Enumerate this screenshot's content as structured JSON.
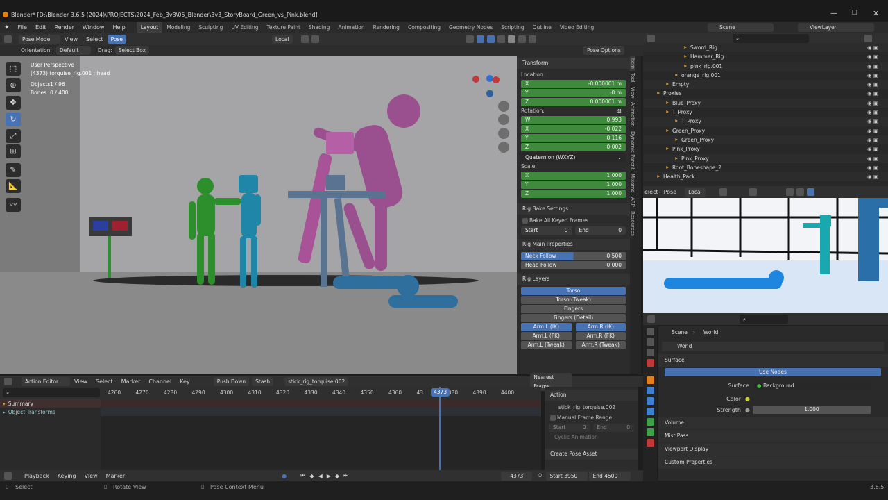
{
  "window": {
    "title": "Blender* [D:\\Blender 3.6.5 (2024)\\PROJECTS\\2024_Feb_3v3\\05_Blender\\3v3_StoryBoard_Green_vs_Pink.blend]"
  },
  "menu": [
    "File",
    "Edit",
    "Render",
    "Window",
    "Help"
  ],
  "workspaces": [
    "Layout",
    "Modeling",
    "Sculpting",
    "UV Editing",
    "Texture Paint",
    "Shading",
    "Animation",
    "Rendering",
    "Compositing",
    "Geometry Nodes",
    "Scripting",
    "Outline",
    "Video Editing"
  ],
  "scene": "Scene",
  "view_layer": "ViewLayer",
  "viewport_header": {
    "mode": "Pose Mode",
    "view": "View",
    "select": "Select",
    "pose": "Pose",
    "orient": "Local",
    "orientation_label": "Orientation:",
    "orientation_value": "Default",
    "drag_label": "Drag:",
    "drag_value": "Select Box",
    "pose_options": "Pose Options"
  },
  "viewport_overlay": {
    "perspective": "User Perspective",
    "object": "(4373) torquise_rig.001 : head",
    "objects_label": "Objects",
    "objects_value": "1 / 96",
    "bones_label": "Bones",
    "bones_value": "0 / 400"
  },
  "npanel": {
    "transform": "Transform",
    "location": "Location:",
    "loc": [
      {
        "a": "X",
        "v": "-0.000001 m"
      },
      {
        "a": "Y",
        "v": "-0 m"
      },
      {
        "a": "Z",
        "v": "0.000001 m"
      }
    ],
    "rotation": "Rotation:",
    "rot_mode_short": "4L",
    "rot": [
      {
        "a": "W",
        "v": "0.993"
      },
      {
        "a": "X",
        "v": "-0.022"
      },
      {
        "a": "Y",
        "v": "0.116"
      },
      {
        "a": "Z",
        "v": "0.002"
      }
    ],
    "quat": "Quaternion (WXYZ)",
    "scale": "Scale:",
    "scl": [
      {
        "a": "X",
        "v": "1.000"
      },
      {
        "a": "Y",
        "v": "1.000"
      },
      {
        "a": "Z",
        "v": "1.000"
      }
    ],
    "rig_bake": "Rig Bake Settings",
    "bake_all": "Bake All Keyed Frames",
    "start": "Start",
    "start_v": "0",
    "end": "End",
    "end_v": "0",
    "rig_main": "Rig Main Properties",
    "neck_follow": "Neck Follow",
    "neck_v": "0.500",
    "head_follow": "Head Follow",
    "head_v": "0.000",
    "rig_layers": "Rig Layers",
    "torso": "Torso",
    "torso_tweak": "Torso (Tweak)",
    "fingers": "Fingers",
    "fingers_detail": "Fingers (Detail)",
    "arm_l_ik": "Arm.L (IK)",
    "arm_r_ik": "Arm.R (IK)",
    "arm_l_fk": "Arm.L (FK)",
    "arm_r_fk": "Arm.R (FK)",
    "arm_l_tw": "Arm.L (Tweak)",
    "arm_r_tw": "Arm.R (Tweak)"
  },
  "ntabs": [
    "Item",
    "Tool",
    "View",
    "Animation",
    "Dynamic Parent",
    "Mixamo",
    "ARP",
    "Resources"
  ],
  "outliner": [
    {
      "name": "Sword_Rig",
      "indent": 4
    },
    {
      "name": "Hammer_Rig",
      "indent": 4
    },
    {
      "name": "pink_rig.001",
      "indent": 4
    },
    {
      "name": "orange_rig.001",
      "indent": 3
    },
    {
      "name": "Empty",
      "indent": 2
    },
    {
      "name": "Proxies",
      "indent": 1
    },
    {
      "name": "Blue_Proxy",
      "indent": 2
    },
    {
      "name": "T_Proxy",
      "indent": 2
    },
    {
      "name": "T_Proxy",
      "indent": 3
    },
    {
      "name": "Green_Proxy",
      "indent": 2
    },
    {
      "name": "Green_Proxy",
      "indent": 3
    },
    {
      "name": "Pink_Proxy",
      "indent": 2
    },
    {
      "name": "Pink_Proxy",
      "indent": 3
    },
    {
      "name": "Root_Boneshape_2",
      "indent": 2
    },
    {
      "name": "Health_Pack",
      "indent": 1
    }
  ],
  "preview_header": {
    "select": "elect",
    "pose": "Pose",
    "orient": "Local"
  },
  "props": {
    "scene": "Scene",
    "world": "World",
    "world_name": "World",
    "surface": "Surface",
    "use_nodes": "Use Nodes",
    "surface_label": "Surface",
    "surface_value": "Background",
    "color": "Color",
    "strength": "Strength",
    "strength_v": "1.000",
    "volume": "Volume",
    "mist": "Mist Pass",
    "viewport_display": "Viewport Display",
    "custom_props": "Custom Properties"
  },
  "action_editor": {
    "mode": "Action Editor",
    "view": "View",
    "select": "Select",
    "marker": "Marker",
    "channel": "Channel",
    "key": "Key",
    "push": "Push Down",
    "stash": "Stash",
    "action": "stick_rig_torquise.002",
    "snap": "Nearest Frame",
    "frames": [
      "4260",
      "4270",
      "4280",
      "4290",
      "4300",
      "4310",
      "4320",
      "4330",
      "4340",
      "4350",
      "4360",
      "43",
      "4380",
      "4390",
      "4400"
    ],
    "current": "4373",
    "summary": "Summary",
    "obj_transforms": "Object Transforms",
    "side": {
      "action": "Action",
      "action_name": "stick_rig_torquise.002",
      "manual": "Manual Frame Range",
      "start": "Start",
      "start_v": "0",
      "end": "End",
      "end_v": "0",
      "cyclic": "Cyclic Animation",
      "create": "Create Pose Asset"
    }
  },
  "timeline": {
    "playback": "Playback",
    "keying": "Keying",
    "view": "View",
    "marker": "Marker",
    "frame": "4373",
    "start": "Start",
    "start_v": "3950",
    "end": "End",
    "end_v": "4500"
  },
  "status": {
    "select": "Select",
    "rotate": "Rotate View",
    "context": "Pose Context Menu",
    "version": "3.6.5"
  }
}
